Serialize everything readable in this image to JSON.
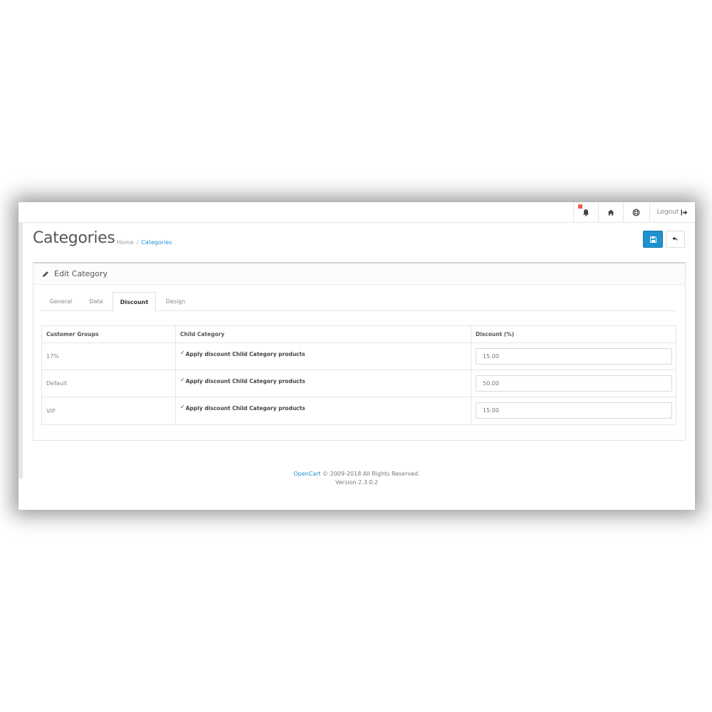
{
  "header": {
    "logout_label": "Logout"
  },
  "page": {
    "title": "Categories",
    "breadcrumb": [
      {
        "label": "Home"
      },
      {
        "label": "Categories"
      }
    ]
  },
  "panel": {
    "title": "Edit Category"
  },
  "tabs": [
    {
      "label": "General",
      "active": false
    },
    {
      "label": "Data",
      "active": false
    },
    {
      "label": "Discount",
      "active": true
    },
    {
      "label": "Design",
      "active": false
    }
  ],
  "table": {
    "headers": [
      "Customer Groups",
      "Child Category",
      "Discount (%)"
    ],
    "rows": [
      {
        "group": "17%",
        "child_label": "Apply discount Child Category products",
        "discount": "15.00"
      },
      {
        "group": "Default",
        "child_label": "Apply discount Child Category products",
        "discount": "50.00"
      },
      {
        "group": "VIP",
        "child_label": "Apply discount Child Category products",
        "discount": "15.00"
      }
    ]
  },
  "footer": {
    "brand": "OpenCart",
    "copyright": " © 2009-2018 All Rights Reserved.",
    "version": "Version 2.3.0.2"
  },
  "colors": {
    "primary": "#1e91cf",
    "badge": "#f05a4a"
  }
}
